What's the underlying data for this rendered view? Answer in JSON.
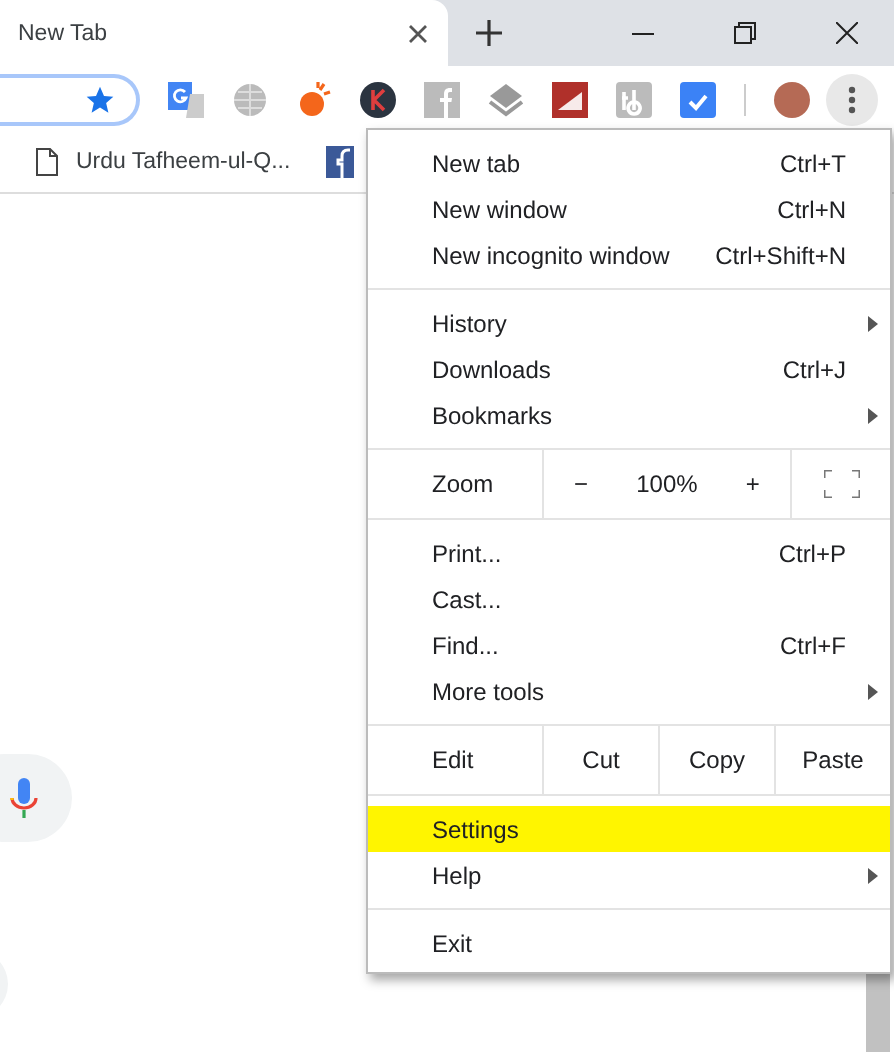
{
  "tab": {
    "title": "New Tab",
    "selected": true
  },
  "bookmarks": [
    {
      "label": "Urdu Tafheem-ul-Q..."
    }
  ],
  "menu": {
    "sections": [
      [
        {
          "kind": "item",
          "label": "New tab",
          "shortcut": "Ctrl+T",
          "submenu": false,
          "selected": false
        },
        {
          "kind": "item",
          "label": "New window",
          "shortcut": "Ctrl+N",
          "submenu": false,
          "selected": false
        },
        {
          "kind": "item",
          "label": "New incognito window",
          "shortcut": "Ctrl+Shift+N",
          "submenu": false,
          "selected": false
        }
      ],
      [
        {
          "kind": "item",
          "label": "History",
          "submenu": true,
          "selected": false
        },
        {
          "kind": "item",
          "label": "Downloads",
          "shortcut": "Ctrl+J",
          "submenu": false,
          "selected": false
        },
        {
          "kind": "item",
          "label": "Bookmarks",
          "submenu": true,
          "selected": false
        }
      ],
      [
        {
          "kind": "zoom",
          "label": "Zoom",
          "minus": "−",
          "value": "100%",
          "plus": "+"
        }
      ],
      [
        {
          "kind": "item",
          "label": "Print...",
          "shortcut": "Ctrl+P",
          "submenu": false,
          "selected": false
        },
        {
          "kind": "item",
          "label": "Cast...",
          "submenu": false,
          "selected": false
        },
        {
          "kind": "item",
          "label": "Find...",
          "shortcut": "Ctrl+F",
          "submenu": false,
          "selected": false
        },
        {
          "kind": "item",
          "label": "More tools",
          "submenu": true,
          "selected": false
        }
      ],
      [
        {
          "kind": "edit",
          "label": "Edit",
          "actions": [
            "Cut",
            "Copy",
            "Paste"
          ]
        }
      ],
      [
        {
          "kind": "item",
          "label": "Settings",
          "submenu": false,
          "selected": true
        },
        {
          "kind": "item",
          "label": "Help",
          "submenu": true,
          "selected": false
        }
      ],
      [
        {
          "kind": "item",
          "label": "Exit",
          "submenu": false,
          "selected": false
        }
      ]
    ]
  }
}
